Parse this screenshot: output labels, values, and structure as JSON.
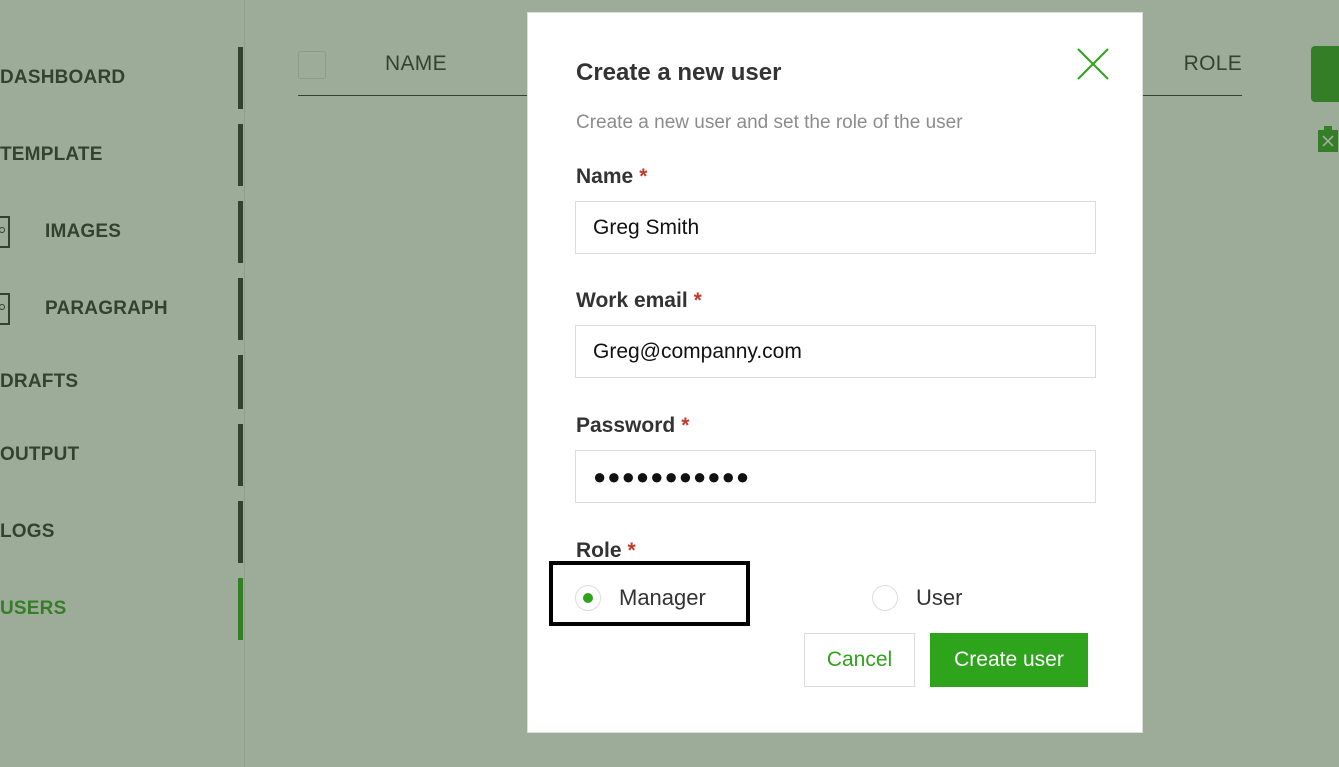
{
  "sidebar": {
    "items": [
      {
        "label": "DASHBOARD"
      },
      {
        "label": "TEMPLATE"
      },
      {
        "label": "IMAGES"
      },
      {
        "label": "PARAGRAPH"
      },
      {
        "label": "DRAFTS"
      },
      {
        "label": "OUTPUT"
      },
      {
        "label": "LOGS"
      },
      {
        "label": "USERS",
        "active": true
      }
    ]
  },
  "table": {
    "columns": [
      "NAME",
      "ROLE"
    ]
  },
  "modal": {
    "title": "Create a new user",
    "subtitle": "Create a new user and set the role of the user",
    "required_mark": "*",
    "fields": {
      "name": {
        "label": "Name",
        "value": "Greg Smith"
      },
      "email": {
        "label": "Work email",
        "value": "Greg@companny.com"
      },
      "password": {
        "label": "Password",
        "value": "●●●●●●●●●●●"
      }
    },
    "role": {
      "label": "Role",
      "options": [
        "Manager",
        "User"
      ],
      "selected": "Manager"
    },
    "buttons": {
      "cancel": "Cancel",
      "create": "Create user"
    }
  },
  "colors": {
    "accent": "#2ea31c",
    "text": "#333333",
    "required": "#c0392b"
  }
}
